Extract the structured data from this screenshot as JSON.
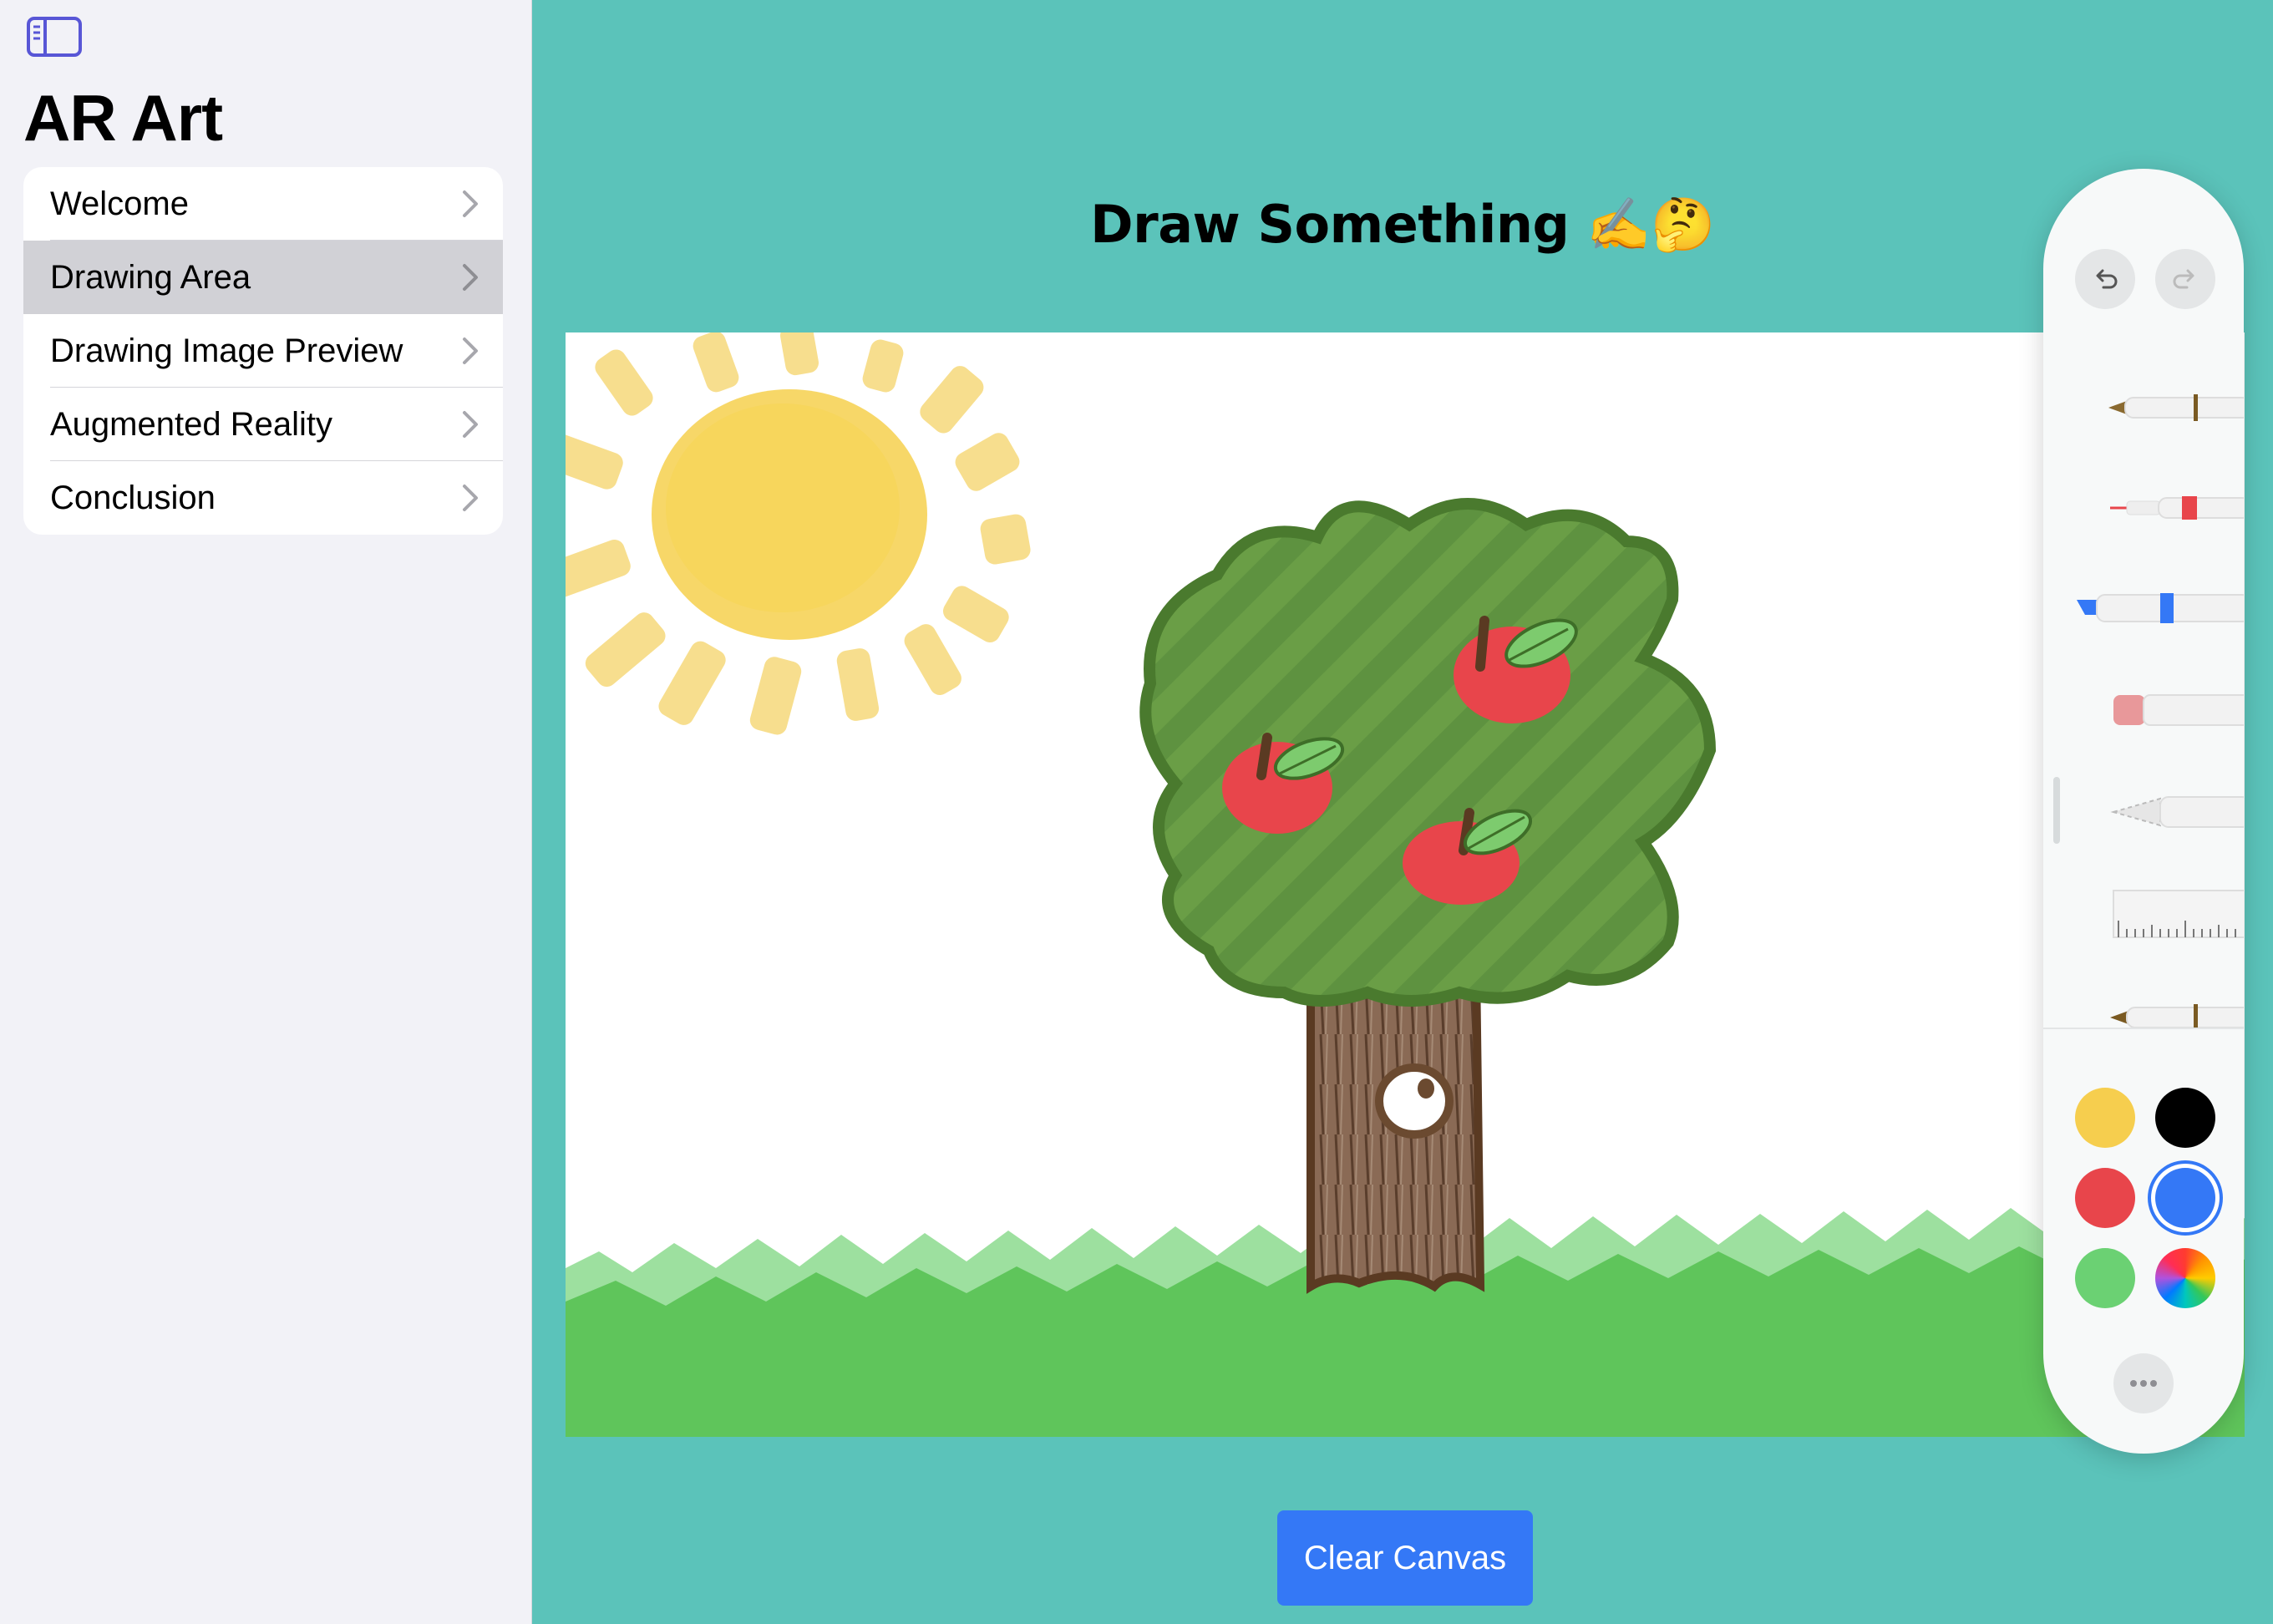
{
  "sidebar": {
    "toggle_icon": "sidebar-toggle-icon",
    "title": "AR Art",
    "items": [
      {
        "label": "Welcome",
        "selected": false
      },
      {
        "label": "Drawing Area",
        "selected": true
      },
      {
        "label": "Drawing Image Preview",
        "selected": false
      },
      {
        "label": "Augmented Reality",
        "selected": false
      },
      {
        "label": "Conclusion",
        "selected": false
      }
    ]
  },
  "main": {
    "title": "Draw Something ✍️🤔",
    "clear_button": "Clear Canvas",
    "background_color": "#5BC3BA",
    "accent_color": "#3478F6"
  },
  "palette": {
    "undo_icon": "undo-icon",
    "redo_icon": "redo-icon",
    "tools": [
      "pen-tool-icon",
      "fineliner-tool-icon",
      "marker-tool-icon",
      "eraser-tool-icon",
      "lasso-tool-icon",
      "ruler-tool-icon",
      "pencil-tool-icon"
    ],
    "colors": [
      {
        "name": "yellow",
        "hex": "#F6CE4E"
      },
      {
        "name": "black",
        "hex": "#000000"
      },
      {
        "name": "red",
        "hex": "#E8454B"
      },
      {
        "name": "blue",
        "hex": "#3478F6",
        "selected": true
      },
      {
        "name": "green",
        "hex": "#6BD173"
      },
      {
        "name": "multicolor",
        "hex": "conic"
      }
    ],
    "more_icon": "more-icon"
  }
}
